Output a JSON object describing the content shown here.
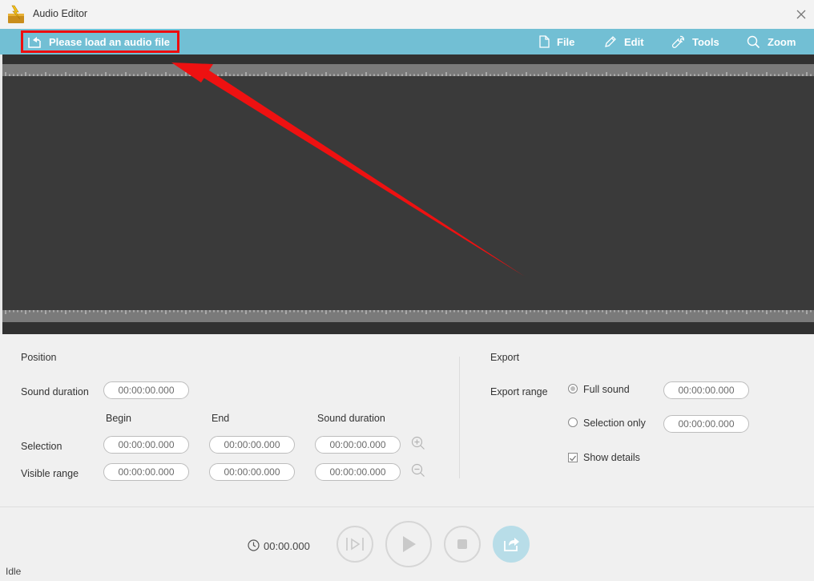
{
  "window": {
    "title": "Audio Editor"
  },
  "toolbar": {
    "load_button": "Please load an audio file",
    "menu": [
      {
        "label": "File",
        "icon": "file-icon"
      },
      {
        "label": "Edit",
        "icon": "pencil-icon"
      },
      {
        "label": "Tools",
        "icon": "wrench-icon"
      },
      {
        "label": "Zoom",
        "icon": "magnifier-icon"
      }
    ]
  },
  "position": {
    "title": "Position",
    "sound_duration_label": "Sound duration",
    "sound_duration_value": "00:00:00.000",
    "columns": [
      "Begin",
      "End",
      "Sound duration"
    ],
    "selection": {
      "label": "Selection",
      "begin": "00:00:00.000",
      "end": "00:00:00.000",
      "duration": "00:00:00.000"
    },
    "visible_range": {
      "label": "Visible range",
      "begin": "00:00:00.000",
      "end": "00:00:00.000",
      "duration": "00:00:00.000"
    }
  },
  "export": {
    "title": "Export",
    "range_label": "Export range",
    "full_sound_label": "Full sound",
    "full_sound_value": "00:00:00.000",
    "selection_only_label": "Selection only",
    "selection_only_value": "00:00:00.000",
    "show_details_label": "Show details",
    "selected_range": "Full sound",
    "show_details_checked": true
  },
  "player": {
    "time": "00:00.000"
  },
  "status": {
    "text": "Idle"
  },
  "colors": {
    "toolbar": "#72bfd4",
    "highlight": "#ee0d0d",
    "waveform_bg": "#3a3a3a",
    "export_button": "#b8dde8"
  }
}
